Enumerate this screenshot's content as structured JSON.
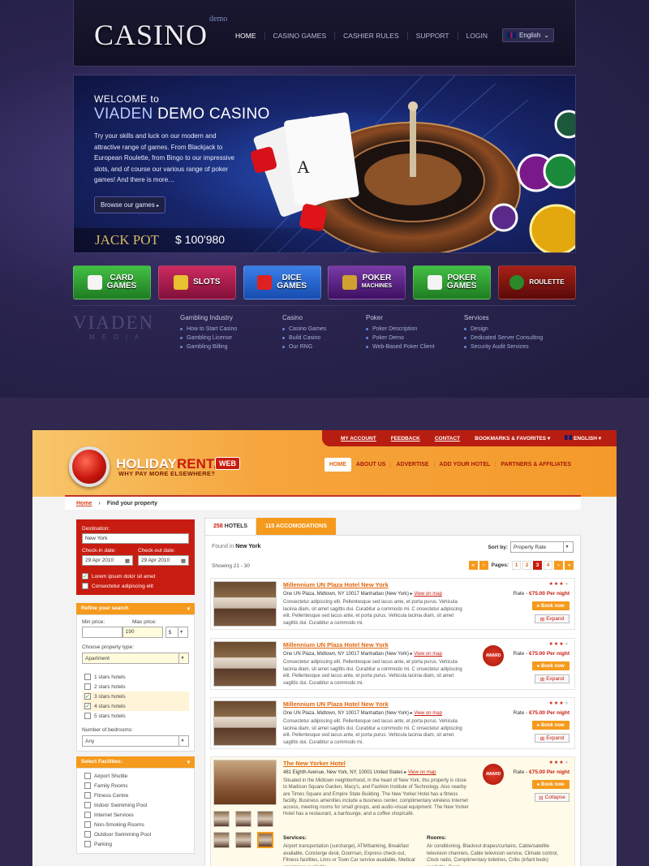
{
  "casino": {
    "logo": "CASINO",
    "logo_sup": "demo",
    "nav": [
      "HOME",
      "CASINO GAMES",
      "CASHIER RULES",
      "SUPPORT",
      "LOGIN"
    ],
    "language": "English",
    "hero": {
      "welcome": "WELCOME to",
      "title_a": "VIADEN",
      "title_b": " DEMO CASINO",
      "text": "Try your skills and luck on our modern and attractive range of games. From Blackjack to European Roulette, from Bingo to our impressive slots, and of course our various range of poker games! And there is more…",
      "button": "Browse our games",
      "jackpot_label": "JACK POT",
      "jackpot_value": "$ 100'980"
    },
    "games": [
      {
        "l1": "CARD",
        "l2": "GAMES",
        "color": "#2aa02a"
      },
      {
        "l1": "SLOTS",
        "l2": "",
        "color": "#b0124a"
      },
      {
        "l1": "DICE",
        "l2": "GAMES",
        "color": "#1a5fd0"
      },
      {
        "l1": "POKER",
        "l2": "MACHINES",
        "color": "#5a1a8a"
      },
      {
        "l1": "POKER",
        "l2": "GAMES",
        "color": "#2aa02a"
      },
      {
        "l1": "ROULETTE",
        "l2": "",
        "color": "#8a1410"
      }
    ],
    "footer": {
      "brand": "VIADEN",
      "brand_sub": "MEDIA",
      "columns": [
        {
          "title": "Gambling Industry",
          "items": [
            "How to Start Casino",
            "Gambling License",
            "Gambling Billing"
          ]
        },
        {
          "title": "Casino",
          "items": [
            "Casino Games",
            "Build Casino",
            "Our RNG"
          ]
        },
        {
          "title": "Poker",
          "items": [
            "Poker Description",
            "Poker Demo",
            "Web-Based Poker Client"
          ]
        },
        {
          "title": "Services",
          "items": [
            "Design",
            "Dedicated Server Consulting",
            "Security Audit Services"
          ]
        }
      ]
    }
  },
  "rental": {
    "topbar": [
      "MY ACCOUNT",
      "FEEDBACK",
      "CONTACT",
      "BOOKMARKS & FAVORITES",
      "ENGLISH"
    ],
    "logo_a": "HOLIDAY",
    "logo_b": "RENTAL",
    "logo_web": "WEB",
    "tagline": "WHY PAY MORE ELSEWHERE?",
    "nav": [
      "HOME",
      "ABOUT US",
      "ADVERTISE",
      "ADD YOUR HOTEL",
      "PARTNERS & AFFILIATES"
    ],
    "breadcrumb": {
      "home": "Home",
      "current": "Find your property"
    },
    "search": {
      "destination_label": "Destination:",
      "destination_value": "New York",
      "checkin_label": "Check-in date:",
      "checkin_value": "29 Apr 2010",
      "checkout_label": "Check-out date:",
      "checkout_value": "29 Apr 2010",
      "check1": "Lorem ipsum dolor sit amet",
      "check2": "Consectetur adipiscing elit"
    },
    "refine": {
      "title": "Refine your search",
      "min_price_label": "Min price:",
      "max_price_label": "Max price:",
      "max_price_value": "190",
      "currency": "$",
      "type_label": "Choose property type:",
      "type_value": "Apartment",
      "stars": [
        "1 stars hotels",
        "2 stars hotels",
        "3 stars hotels",
        "4 stars hotels",
        "5 stars hotels"
      ],
      "bedrooms_label": "Number of bedrooms:",
      "bedrooms_value": "Any"
    },
    "facilities": {
      "title": "Select Facilities:",
      "items": [
        "Airport Shuttle",
        "Family Rooms",
        "Fitness Centre",
        "Indoor Swimming Pool",
        "Internet Services",
        "Non-Smoking Rooms",
        "Outdoor Swimming Pool",
        "Parking"
      ]
    },
    "results": {
      "tab1_count": "258",
      "tab1_label": " HOTELS",
      "tab2_count": "115",
      "tab2_label": " ACCOMODATIONS",
      "found_label": "Found in ",
      "found_city": "New York",
      "sort_label": "Sort by:",
      "sort_value": "Property Rate",
      "showing": "Showing 21 - 30",
      "pages_label": "Pages:",
      "pages": [
        "1",
        "2",
        "3",
        "4"
      ],
      "current_page": "3"
    },
    "hotels": [
      {
        "name": "Millennium UN Plaza Hotel New York",
        "address": "One UN Plaza, Midtown, NY 10017 Manhattan (New York)",
        "map": "View on map",
        "desc": "Consectetur adipiscing elit. Pellentesque sed lacus ante, et porta purus. Vehicula lacinia diam, sit amet sagittis dui. Curabitur a commodo mi. C onsectetur adipiscing elit. Pellentesque sed lacus ante, et porta purus. Vehicula lacinia diam, sit amet sagittis dui. Curabitur a commodo mi.",
        "rate_label": "Rate - ",
        "rate": "€75.00 Per night",
        "book": "Book now",
        "toggle": "Expand",
        "award": ""
      },
      {
        "name": "Millennium UN Plaza Hotel New York",
        "address": "One UN Plaza, Midtown, NY 10017 Manhattan (New York)",
        "map": "View on map",
        "desc": "Consectetur adipiscing elit. Pellentesque sed lacus ante, et porta purus. Vehicula lacinia diam, sit amet sagittis dui. Curabitur a commodo mi. C onsectetur adipiscing elit. Pellentesque sed lacus ante, et porta purus. Vehicula lacinia diam, sit amet sagittis dui. Curabitur a commodo mi.",
        "rate_label": "Rate - ",
        "rate": "€75.00 Per night",
        "book": "Book now",
        "toggle": "Expand",
        "award": "AWARD"
      },
      {
        "name": "Millennium UN Plaza Hotel New York",
        "address": "One UN Plaza, Midtown, NY 10017 Manhattan (New York)",
        "map": "View on map",
        "desc": "Consectetur adipiscing elit. Pellentesque sed lacus ante, et porta purus. Vehicula lacinia diam, sit amet sagittis dui. Curabitur a commodo mi. C onsectetur adipiscing elit. Pellentesque sed lacus ante, et porta purus. Vehicula lacinia diam, sit amet sagittis dui. Curabitur a commodo mi.",
        "rate_label": "Rate - ",
        "rate": "€75.00 Per night",
        "book": "Book now",
        "toggle": "Expand",
        "award": ""
      },
      {
        "name": "The New Yorker Hotel",
        "address": "481 Eighth Avenue, New York, NY, 10001 United States",
        "map": "View on map",
        "desc": "Situated in the Midtown neighborhood, in the heart of New York, this property is close to Madison Square Garden, Macy's, and Fashion Institute of Technology. Also nearby are Times Square and Empire State Building. The New Yorker Hotel has a fitness facility. Business amenities include a business center, complimentary wireless Internet access, meeting rooms for small groups, and audio-visual equipment. The New Yorker Hotel has a restaurant, a bar/lounge, and a coffee shop/café.",
        "rate_label": "Rate - ",
        "rate": "€75.00 Per night",
        "book": "Book now",
        "toggle": "Collapse",
        "award": "AWARD",
        "services_title": "Services:",
        "services": "Airport transportation (surcharge), ATM/banking, Breakfast available, Concierge desk, Doorman, Express check-out, Fitness facilities, Limo or Town Car service available, Medical assistance available ...",
        "rooms_title": "Rooms:",
        "rooms": "Air conditioning, Blackout drapes/curtains, Cable/satellite television channels, Cable television service, Climate control, Clock radio, Complimentary toiletries, Cribs (infant beds) available, Desk ..."
      }
    ]
  }
}
